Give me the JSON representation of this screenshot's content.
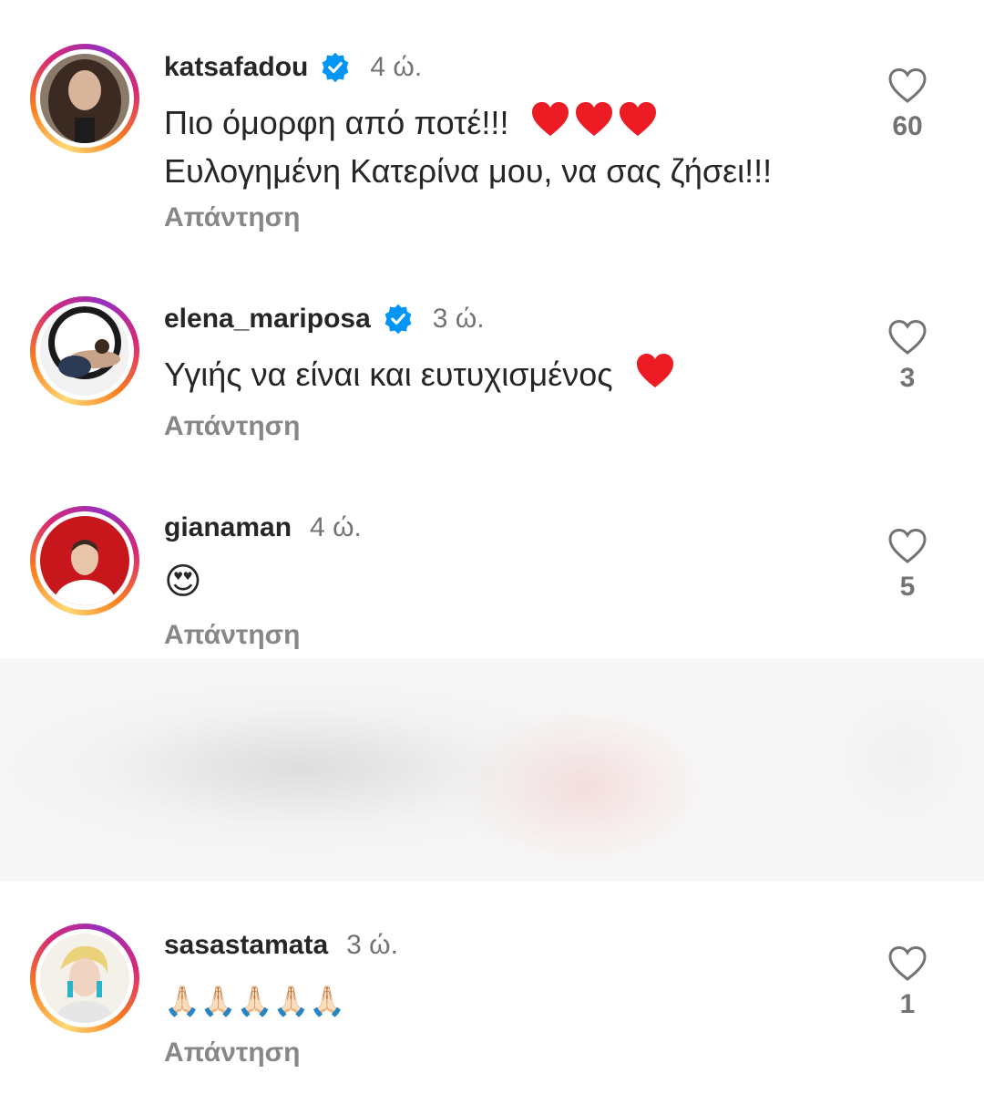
{
  "comments": [
    {
      "username": "katsafadou",
      "verified": true,
      "time": "4 ώ.",
      "text_line1": "Πιο όμορφη από ποτέ!!!",
      "text_line2": "Ευλογημένη Κατερίνα μου, να σας ζήσει!!!",
      "reply": "Απάντηση",
      "likes": "60"
    },
    {
      "username": "elena_mariposa",
      "verified": true,
      "time": "3 ώ.",
      "text_line1": "Υγιής να είναι και ευτυχισμένος",
      "reply": "Απάντηση",
      "likes": "3"
    },
    {
      "username": "gianaman",
      "verified": false,
      "time": "4 ώ.",
      "text_line1": "😍",
      "reply": "Απάντηση",
      "likes": "5"
    },
    {
      "username": "sasastamata",
      "verified": false,
      "time": "3 ώ.",
      "text_line1": "🙏🏻🙏🏻🙏🏻🙏🏻🙏🏻",
      "reply": "Απάντηση",
      "likes": "1"
    }
  ],
  "colors": {
    "verified_blue": "#0095f6",
    "heart_red": "#ed1c24",
    "secondary_text": "#737373",
    "primary_text": "#262626"
  },
  "icons": {
    "like": "heart-outline-icon",
    "verified": "verified-badge-icon",
    "emoji_heart": "red-heart-emoji"
  }
}
